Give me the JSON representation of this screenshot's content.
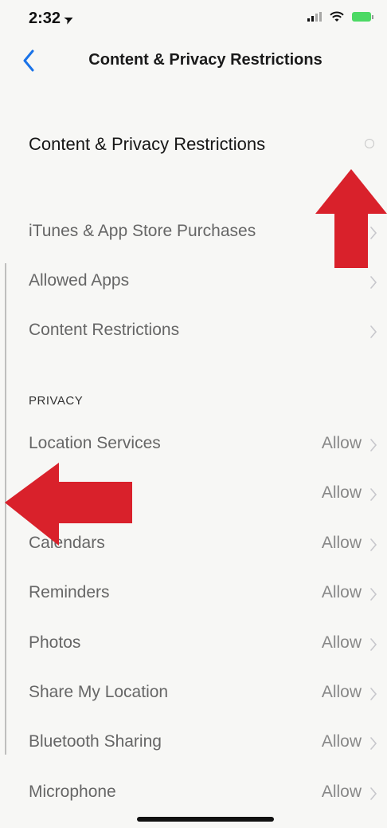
{
  "status_bar": {
    "time": "2:32",
    "location_glyph": "➤",
    "icons": [
      "signal-icon",
      "wifi-icon",
      "battery-icon"
    ]
  },
  "nav": {
    "title": "Content & Privacy Restrictions",
    "back_icon": "chevron-left-icon"
  },
  "master": {
    "label": "Content & Privacy Restrictions",
    "enabled": false
  },
  "content_rows": [
    {
      "label": "iTunes & App Store Purchases",
      "value": ""
    },
    {
      "label": "Allowed Apps",
      "value": ""
    },
    {
      "label": "Content Restrictions",
      "value": ""
    }
  ],
  "privacy": {
    "header": "PRIVACY",
    "rows": [
      {
        "label": "Location Services",
        "value": "Allow"
      },
      {
        "label": "",
        "value": "Allow"
      },
      {
        "label": "Calendars",
        "value": "Allow"
      },
      {
        "label": "Reminders",
        "value": "Allow"
      },
      {
        "label": "Photos",
        "value": "Allow"
      },
      {
        "label": "Share My Location",
        "value": "Allow"
      },
      {
        "label": "Bluetooth Sharing",
        "value": "Allow"
      },
      {
        "label": "Microphone",
        "value": "Allow"
      }
    ]
  },
  "annotations": [
    "red-up-arrow-icon",
    "red-left-arrow-icon"
  ],
  "colors": {
    "accent": "#1a73e8",
    "annotation_red": "#d9212b",
    "battery_green": "#4cd964"
  }
}
